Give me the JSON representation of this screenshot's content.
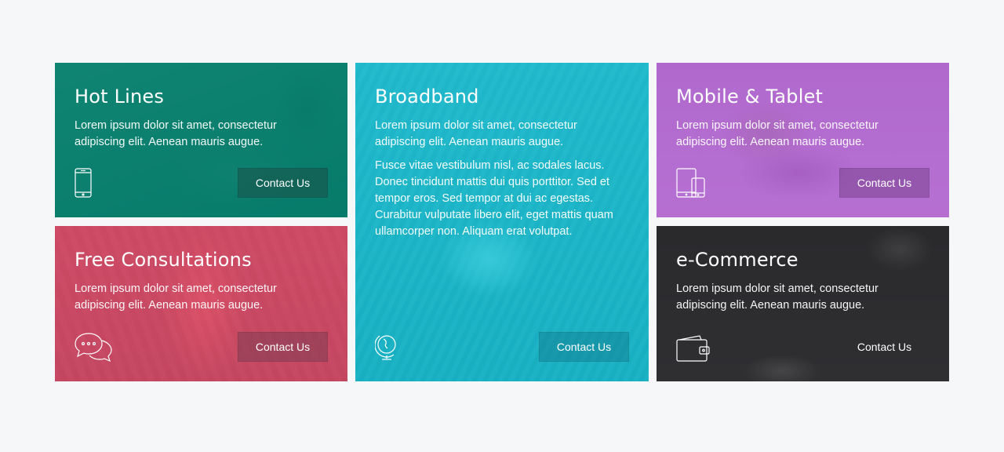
{
  "cards": [
    {
      "title": "Hot Lines",
      "text": "Lorem ipsum dolor sit amet, consectetur adipiscing elit. Aenean mauris augue.",
      "button": "Contact Us",
      "icon": "smartphone-icon",
      "color": "#0e8c78"
    },
    {
      "title": "Broadband",
      "text": "Lorem ipsum dolor sit amet, consectetur adipiscing elit. Aenean mauris augue.",
      "extra": "Fusce vitae vestibulum nisl, ac sodales lacus. Donec tincidunt mattis dui quis porttitor. Sed et tempor eros. Sed tempor at dui ac egestas. Curabitur vulputate libero elit, eget mattis quam ullamcorper non. Aliquam erat volutpat.",
      "button": "Contact Us",
      "icon": "globe-icon",
      "color": "#2ec4d6"
    },
    {
      "title": "Mobile & Tablet",
      "text": "Lorem ipsum dolor sit amet, consectetur adipiscing elit. Aenean mauris augue.",
      "button": "Contact Us",
      "icon": "tablet-phone-icon",
      "color": "#b873d3"
    },
    {
      "title": "Free Consultations",
      "text": "Lorem ipsum dolor sit amet, consectetur adipiscing elit. Aenean mauris augue.",
      "button": "Contact Us",
      "icon": "chat-bubbles-icon",
      "color": "#d8536f"
    },
    {
      "title": "e-Commerce",
      "text": "Lorem ipsum dolor sit amet, consectetur adipiscing elit. Aenean mauris augue.",
      "button": "Contact Us",
      "icon": "wallet-icon",
      "color": "#3a3a3d"
    }
  ]
}
